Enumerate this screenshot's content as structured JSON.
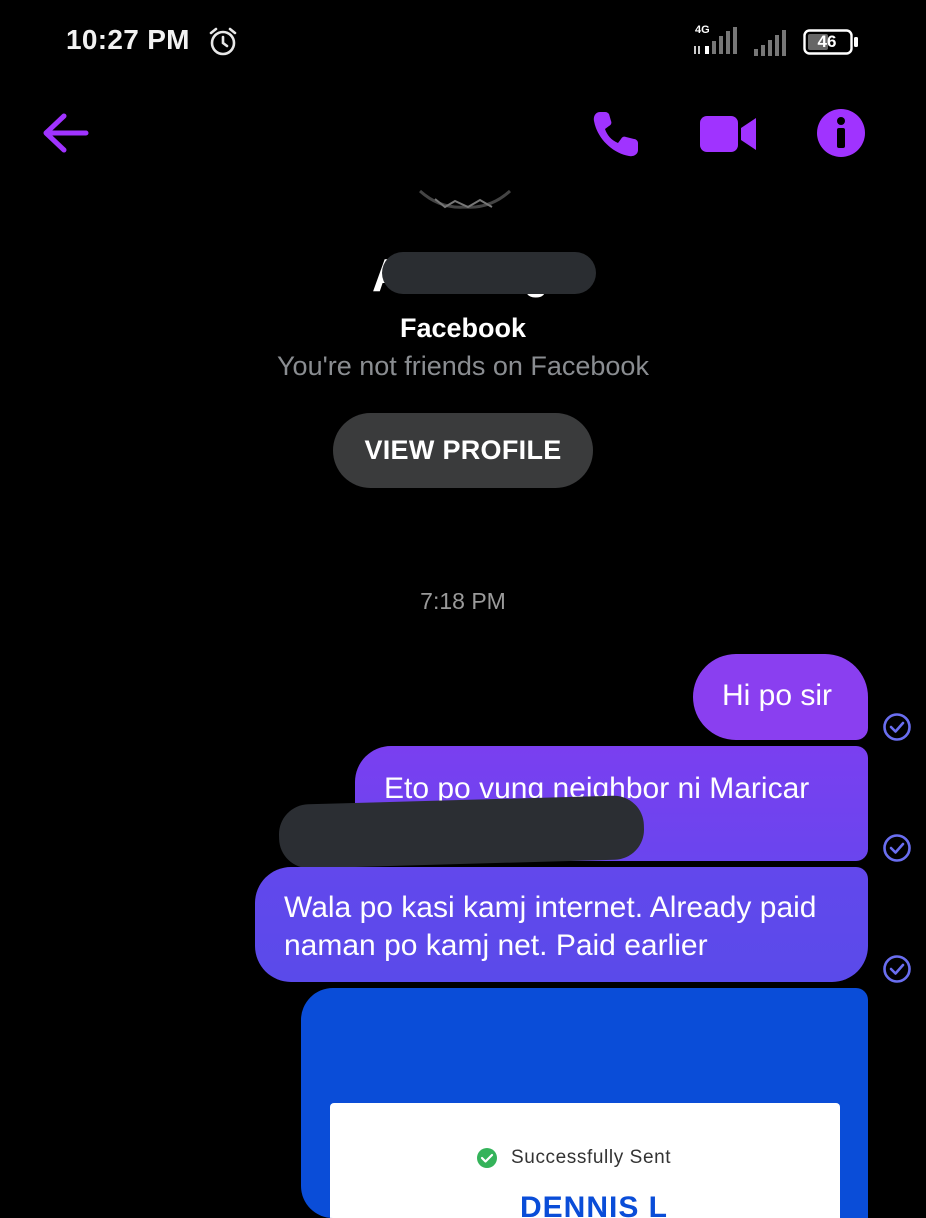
{
  "status_bar": {
    "time": "10:27 PM",
    "network": "4G",
    "battery": "46",
    "icons": [
      "alarm-icon",
      "signal-icon",
      "signal-icon",
      "battery-icon"
    ]
  },
  "header": {
    "icons": [
      "back-arrow-icon",
      "phone-icon",
      "video-camera-icon",
      "info-icon"
    ],
    "accent_color": "#a033ff"
  },
  "profile": {
    "name_visible_start": "A",
    "name_visible_end": "g",
    "platform": "Facebook",
    "subtitle": "You're not friends on Facebook",
    "view_profile_label": "VIEW PROFILE"
  },
  "conversation": {
    "timestamp": "7:18 PM",
    "messages": [
      {
        "text": "Hi po sir",
        "status": "sent"
      },
      {
        "text": "Eto po vung neighbor ni Maricar",
        "status": "sent"
      },
      {
        "text": "Wala po kasi kamj internet. Already paid naman po kamj net. Paid earlier",
        "status": "sent"
      }
    ],
    "attachment": {
      "status_text": "Successfully Sent",
      "name_partial": "DENNIS L"
    }
  }
}
